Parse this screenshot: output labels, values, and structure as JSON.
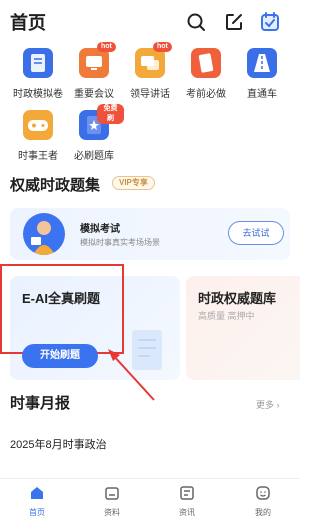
{
  "header": {
    "title": "首页"
  },
  "grid": {
    "items": [
      {
        "label": "时政模拟卷",
        "color": "#3a6fe8",
        "icon": "book-icon"
      },
      {
        "label": "重要会议",
        "color": "#f07a3a",
        "icon": "monitor-icon",
        "badge": "hot"
      },
      {
        "label": "领导讲话",
        "color": "#f3a93a",
        "icon": "speech-icon",
        "badge": "hot"
      },
      {
        "label": "考前必做",
        "color": "#f0603a",
        "icon": "notes-icon"
      },
      {
        "label": "直通车",
        "color": "#3a6fe8",
        "icon": "road-icon"
      },
      {
        "label": "时事王者",
        "color": "#f3a93a",
        "icon": "gamepad-icon"
      },
      {
        "label": "必刷题库",
        "color": "#3a6fe8",
        "icon": "star-book-icon",
        "badge": "免费刷"
      }
    ]
  },
  "section1": {
    "title": "权威时政题集",
    "vip": "VIP专享"
  },
  "exam": {
    "title": "模拟考试",
    "subtitle": "模拟时事真实考场场景",
    "button": "去试试"
  },
  "card_blue": {
    "title": "E-AI全真刷题",
    "button": "开始刷题"
  },
  "card_red": {
    "title": "时政权威题库",
    "subtitle": "高质量 高押中"
  },
  "section2": {
    "title": "时事月报",
    "more": "更多 ›"
  },
  "news": {
    "item": "2025年8月时事政治"
  },
  "tabbar": {
    "tabs": [
      {
        "label": "首页",
        "active": true
      },
      {
        "label": "资料"
      },
      {
        "label": "资讯"
      },
      {
        "label": "我的"
      }
    ]
  },
  "colors": {
    "accent": "#3b72ee",
    "highlight": "#e53935"
  }
}
